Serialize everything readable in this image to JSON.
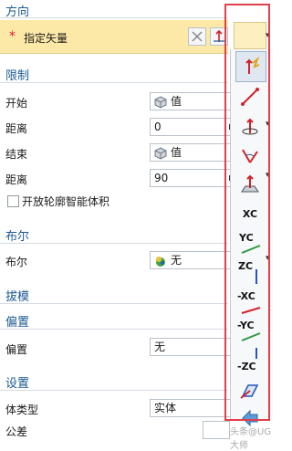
{
  "direction": {
    "title": "方向",
    "specify_vector_label": "指定矢量",
    "required_mark": "*"
  },
  "limits": {
    "title": "限制",
    "start_label": "开始",
    "start_value": "值",
    "start_distance_label": "距离",
    "start_distance_value": "0",
    "end_label": "结束",
    "end_value": "值",
    "end_distance_label": "距离",
    "end_distance_value": "90",
    "unit": "m",
    "open_profile_label": "开放轮廓智能体积"
  },
  "boolean": {
    "title": "布尔",
    "label": "布尔",
    "value": "无"
  },
  "draft": {
    "title": "拔模"
  },
  "offset": {
    "title": "偏置",
    "label": "偏置",
    "value": "无"
  },
  "settings": {
    "title": "设置",
    "body_type_label": "体类型",
    "body_type_value": "实体",
    "tolerance_label": "公差"
  },
  "vector_menu": {
    "items": [
      {
        "icon": "auto-vector-icon",
        "label": ""
      },
      {
        "icon": "two-points-icon",
        "label": ""
      },
      {
        "icon": "curve-vector-icon",
        "label": ""
      },
      {
        "icon": "angle-vector-icon",
        "label": ""
      },
      {
        "icon": "face-normal-icon",
        "label": ""
      },
      {
        "icon": "xc-axis-icon",
        "label": "XC"
      },
      {
        "icon": "yc-axis-icon",
        "label": "YC"
      },
      {
        "icon": "zc-axis-icon",
        "label": "ZC"
      },
      {
        "icon": "neg-xc-axis-icon",
        "label": "-XC"
      },
      {
        "icon": "neg-yc-axis-icon",
        "label": "-YC"
      },
      {
        "icon": "neg-zc-axis-icon",
        "label": "-ZC"
      },
      {
        "icon": "view-direction-icon",
        "label": ""
      },
      {
        "icon": "reverse-direction-icon",
        "label": ""
      }
    ]
  },
  "watermark": "头条@UG大师",
  "colors": {
    "section_title": "#1c5a92",
    "highlight_row": "#fde9a7",
    "annotation_box": "#e0404a"
  }
}
